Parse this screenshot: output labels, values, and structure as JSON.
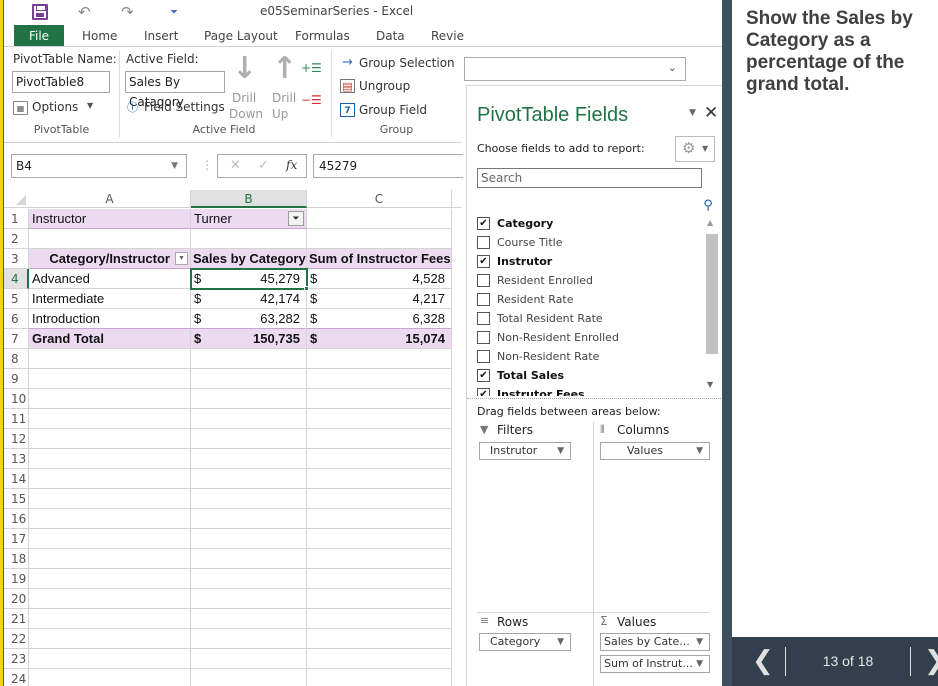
{
  "window": {
    "title": "e05SeminarSeries - Excel",
    "qat": {
      "undo": "↶",
      "redo": "↷",
      "customize": "⏷"
    }
  },
  "ribbon_tabs": [
    "File",
    "Home",
    "Insert",
    "Page Layout",
    "Formulas",
    "Data",
    "Revie"
  ],
  "ribbon": {
    "pivottable_name_label": "PivotTable Name:",
    "pivottable_name_value": "PivotTable8",
    "options_label": "Options",
    "pivottable_group": "PivotTable",
    "active_field_label": "Active Field:",
    "active_field_value": "Sales By Catagory",
    "field_settings_label": "Field Settings",
    "drill_down_label1": "Drill",
    "drill_down_label2": "Down",
    "drill_up_label1": "Drill",
    "drill_up_label2": "Up",
    "active_field_group": "Active Field",
    "group_selection": "Group Selection",
    "ungroup": "Ungroup",
    "group_field": "Group Field",
    "group_group": "Group"
  },
  "formula_bar": {
    "name_box": "B4",
    "formula": "45279",
    "fx": "fx"
  },
  "grid": {
    "columns": [
      "A",
      "B",
      "C"
    ],
    "selected_column": "B",
    "active_row": 4,
    "rows": [
      {
        "num": "1",
        "a": "Instructor",
        "b": "Turner",
        "c": ""
      },
      {
        "num": "2",
        "a": "",
        "b": "",
        "c": ""
      },
      {
        "num": "3",
        "a": "Category/Instructor",
        "b": "Sales by Category",
        "c": "Sum of Instructor Fees"
      },
      {
        "num": "4",
        "a": "Advanced",
        "b_cur": "$",
        "b": "45,279",
        "c_cur": "$",
        "c": "4,528"
      },
      {
        "num": "5",
        "a": "Intermediate",
        "b_cur": "$",
        "b": "42,174",
        "c_cur": "$",
        "c": "4,217"
      },
      {
        "num": "6",
        "a": "Introduction",
        "b_cur": "$",
        "b": "63,282",
        "c_cur": "$",
        "c": "6,328"
      },
      {
        "num": "7",
        "a": "Grand Total",
        "b_cur": "$",
        "b": "150,735",
        "c_cur": "$",
        "c": "15,074"
      },
      {
        "num": "8"
      },
      {
        "num": "9"
      },
      {
        "num": "10"
      },
      {
        "num": "11"
      },
      {
        "num": "12"
      },
      {
        "num": "13"
      },
      {
        "num": "14"
      },
      {
        "num": "15"
      },
      {
        "num": "16"
      },
      {
        "num": "17"
      },
      {
        "num": "18"
      },
      {
        "num": "19"
      },
      {
        "num": "20"
      },
      {
        "num": "21"
      },
      {
        "num": "22"
      },
      {
        "num": "23"
      },
      {
        "num": "24"
      }
    ]
  },
  "pivot_pane": {
    "title": "PivotTable Fields",
    "subtitle": "Choose fields to add to report:",
    "search_placeholder": "Search",
    "fields": [
      {
        "label": "Category",
        "checked": true
      },
      {
        "label": "Course Title",
        "checked": false
      },
      {
        "label": "Instrutor",
        "checked": true
      },
      {
        "label": "Resident Enrolled",
        "checked": false
      },
      {
        "label": "Resident Rate",
        "checked": false
      },
      {
        "label": "Total Resident Rate",
        "checked": false
      },
      {
        "label": "Non-Resident Enrolled",
        "checked": false
      },
      {
        "label": "Non-Resident Rate",
        "checked": false
      },
      {
        "label": "Total Sales",
        "checked": true
      },
      {
        "label": "Instrutor Fees",
        "checked": true
      }
    ],
    "drag_label": "Drag fields between areas below:",
    "areas": {
      "filters": {
        "label": "Filters",
        "items": [
          "Instrutor"
        ]
      },
      "columns": {
        "label": "Columns",
        "items": [
          "Values"
        ]
      },
      "rows": {
        "label": "Rows",
        "items": [
          "Category"
        ]
      },
      "values": {
        "label": "Values",
        "items": [
          "Sales by Cate...",
          "Sum of Instrut..."
        ]
      }
    }
  },
  "instruction": {
    "text": "Show the Sales by Category as a percentage of the grand total.",
    "page": "13 of 18"
  }
}
